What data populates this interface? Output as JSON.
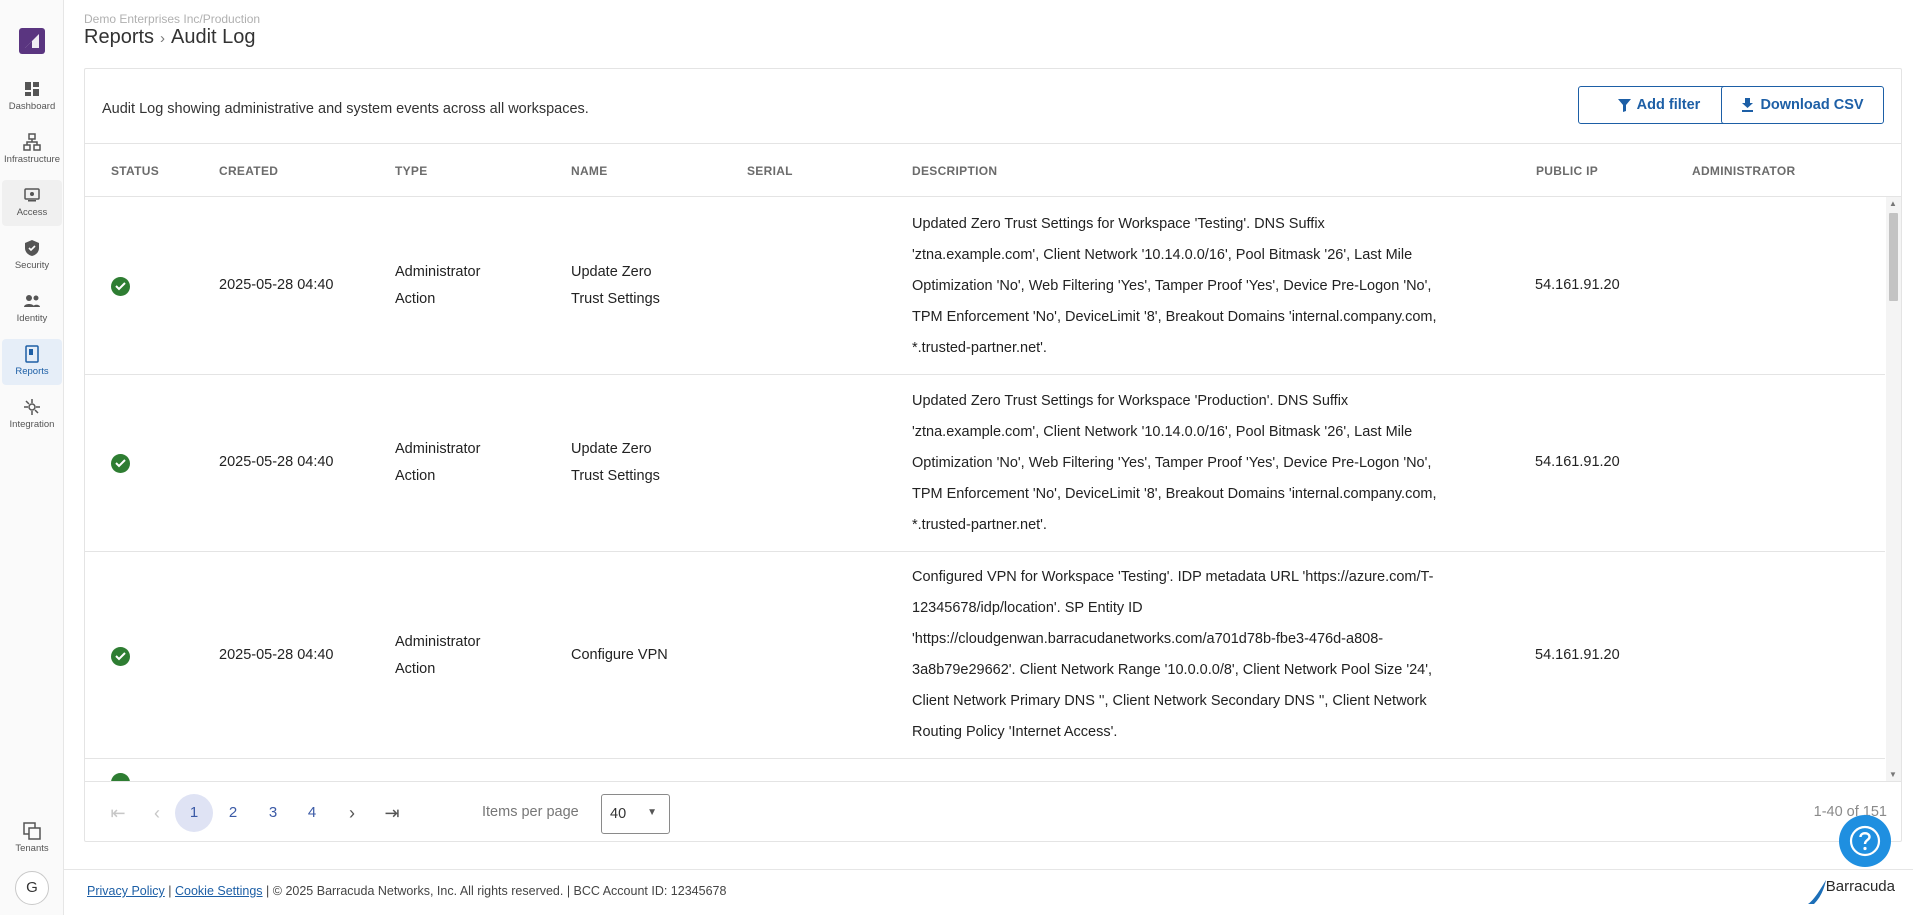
{
  "breadcrumb": {
    "org": "Demo Enterprises Inc/Production",
    "section": "Reports",
    "page": "Audit Log"
  },
  "nav": [
    {
      "label": "Dashboard",
      "icon": "dashboard-icon"
    },
    {
      "label": "Infrastructure",
      "icon": "infrastructure-icon"
    },
    {
      "label": "Access",
      "icon": "access-icon"
    },
    {
      "label": "Security",
      "icon": "shield-icon"
    },
    {
      "label": "Identity",
      "icon": "identity-icon"
    },
    {
      "label": "Reports",
      "icon": "reports-icon"
    },
    {
      "label": "Integration",
      "icon": "integration-icon"
    },
    {
      "label": "Tenants",
      "icon": "tenants-icon"
    }
  ],
  "user": {
    "initial": "G"
  },
  "card": {
    "description": "Audit Log showing administrative and system events across all workspaces.",
    "add_filter_label": "Add filter",
    "download_csv_label": "Download CSV"
  },
  "columns": [
    "STATUS",
    "CREATED",
    "TYPE",
    "NAME",
    "SERIAL",
    "DESCRIPTION",
    "PUBLIC IP",
    "ADMINISTRATOR"
  ],
  "rows": [
    {
      "status": "success",
      "created": "2025-05-28 04:40",
      "type_lines": [
        "Administrator",
        "Action"
      ],
      "name_lines": [
        "Update Zero",
        "Trust Settings"
      ],
      "serial": "",
      "desc_lines": [
        "Updated Zero Trust Settings for Workspace 'Testing'. DNS Suffix",
        "'ztna.example.com', Client Network '10.14.0.0/16', Pool Bitmask '26', Last Mile",
        "Optimization 'No', Web Filtering 'Yes', Tamper Proof 'Yes', Device Pre-Logon 'No',",
        "TPM Enforcement 'No', DeviceLimit '8', Breakout Domains 'internal.company.com,",
        "*.trusted-partner.net'."
      ],
      "public_ip": "54.161.91.20",
      "administrator": ""
    },
    {
      "status": "success",
      "created": "2025-05-28 04:40",
      "type_lines": [
        "Administrator",
        "Action"
      ],
      "name_lines": [
        "Update Zero",
        "Trust Settings"
      ],
      "serial": "",
      "desc_lines": [
        "Updated Zero Trust Settings for Workspace 'Production'. DNS Suffix",
        "'ztna.example.com', Client Network '10.14.0.0/16', Pool Bitmask '26', Last Mile",
        "Optimization 'No', Web Filtering 'Yes', Tamper Proof 'Yes', Device Pre-Logon 'No',",
        "TPM Enforcement 'No', DeviceLimit '8', Breakout Domains 'internal.company.com,",
        "*.trusted-partner.net'."
      ],
      "public_ip": "54.161.91.20",
      "administrator": ""
    },
    {
      "status": "success",
      "created": "2025-05-28 04:40",
      "type_lines": [
        "Administrator",
        "Action"
      ],
      "name_lines": [
        "Configure VPN"
      ],
      "serial": "",
      "desc_lines": [
        "Configured VPN for Workspace 'Testing'. IDP metadata URL 'https://azure.com/T-",
        "12345678/idp/location'. SP Entity ID",
        "'https://cloudgenwan.barracudanetworks.com/a701d78b-fbe3-476d-a808-",
        "3a8b79e29662'. Client Network Range '10.0.0.0/8', Client Network Pool Size '24',",
        "Client Network Primary DNS '', Client Network Secondary DNS '', Client Network",
        "Routing Policy 'Internet Access'."
      ],
      "public_ip": "54.161.91.20",
      "administrator": ""
    }
  ],
  "pagination": {
    "pages": [
      "1",
      "2",
      "3",
      "4"
    ],
    "current_page": "1",
    "items_per_page_label": "Items per page",
    "items_per_page": "40",
    "range": "1-40 of 151"
  },
  "footer": {
    "privacy": "Privacy Policy",
    "cookies": "Cookie Settings",
    "copyright": "| © 2025 Barracuda Networks, Inc. All rights reserved. | BCC Account ID: 12345678",
    "brand": "Barracuda"
  },
  "colors": {
    "accent": "#1d5fa6",
    "success": "#2e7d32",
    "logo": "#5a3580",
    "help": "#1f8fe0"
  }
}
